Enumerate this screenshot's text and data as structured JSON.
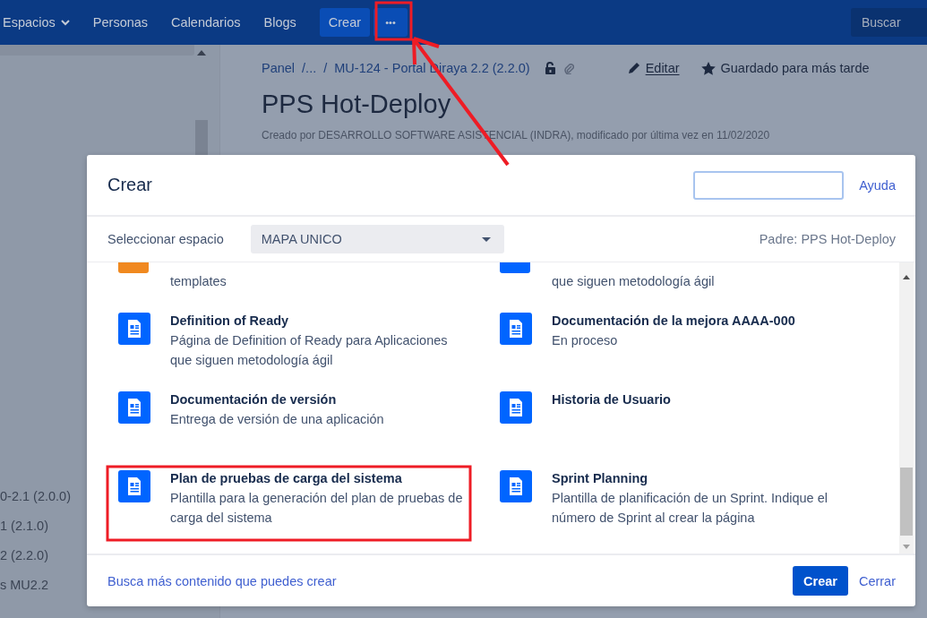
{
  "nav": {
    "items": [
      {
        "label": "Espacios",
        "dropdown": true
      },
      {
        "label": "Personas",
        "dropdown": false
      },
      {
        "label": "Calendarios",
        "dropdown": false
      },
      {
        "label": "Blogs",
        "dropdown": false
      }
    ],
    "create": "Crear",
    "more": "•••",
    "search": {
      "placeholder": "Buscar"
    }
  },
  "sidebar": {
    "items": [
      "0-2.1 (2.0.0)",
      "1 (2.1.0)",
      "2 (2.2.0)",
      "s MU2.2"
    ]
  },
  "page": {
    "breadcrumbs": [
      "Panel",
      "/...",
      "/",
      "MU-124 - Portal Diraya 2.2 (2.2.0)"
    ],
    "actions": [
      {
        "kind": "edit",
        "label": "Editar"
      },
      {
        "kind": "saved",
        "label": "Guardado para más tarde"
      }
    ],
    "title": "PPS Hot-Deploy",
    "byline": "Creado por DESARROLLO SOFTWARE ASISTENCIAL (INDRA), modificado por última vez en 11/02/2020"
  },
  "dialog": {
    "title": "Crear",
    "help": "Ayuda",
    "space_label": "Seleccionar espacio",
    "space": "MAPA UNICO",
    "parent": "Padre: PPS Hot-Deploy",
    "templates": [
      {
        "kind": "partial",
        "color": "#f0891f",
        "description": "templates"
      },
      {
        "kind": "partial",
        "color": "#0065ff",
        "description": "que siguen metodología ágil"
      },
      {
        "kind": "full",
        "color": "#0065ff",
        "title": "Definition of Ready",
        "description": "Página de Definition of Ready para Aplicaciones que siguen metodología ágil"
      },
      {
        "kind": "full",
        "color": "#0065ff",
        "title": "Documentación de la mejora AAAA-000",
        "description": "En proceso"
      },
      {
        "kind": "full",
        "color": "#0065ff",
        "title": "Documentación de versión",
        "description": "Entrega de versión de una aplicación"
      },
      {
        "kind": "full",
        "color": "#0065ff",
        "title": "Historia de Usuario"
      },
      {
        "kind": "full",
        "color": "#0065ff",
        "title": "Plan de pruebas de carga del sistema",
        "description": "Plantilla para la generación del plan de pruebas de carga del sistema"
      },
      {
        "kind": "full",
        "color": "#0065ff",
        "title": "Sprint Planning",
        "description": "Plantilla de planificación de un Sprint. Indique el número de Sprint al crear la página"
      }
    ],
    "more_link": "Busca más contenido que puedes crear",
    "create": "Crear",
    "close": "Cerrar"
  }
}
